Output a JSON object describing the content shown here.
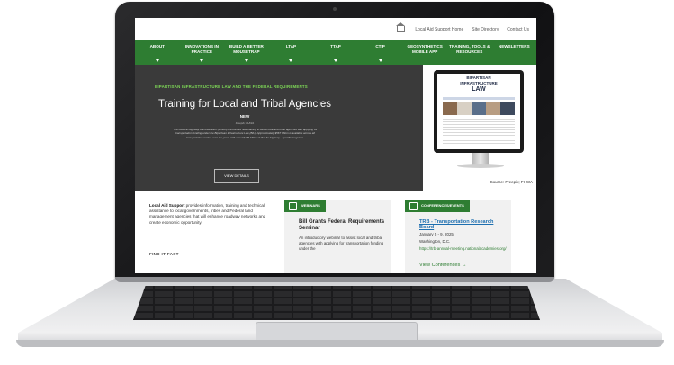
{
  "topbar": {
    "links": [
      "Local Aid Support Home",
      "Site Directory",
      "Contact Us"
    ]
  },
  "nav": {
    "items": [
      {
        "label": "ABOUT"
      },
      {
        "label": "INNOVATIONS IN PRACTICE"
      },
      {
        "label": "BUILD A BETTER MOUSETRAP"
      },
      {
        "label": "LTAP"
      },
      {
        "label": "TTAP"
      },
      {
        "label": "CTIP"
      },
      {
        "label": "GEOSYNTHETICS MOBILE APP"
      },
      {
        "label": "TRAINING, TOOLS & RESOURCES"
      },
      {
        "label": "NEWSLETTERS"
      }
    ]
  },
  "hero": {
    "kicker": "BIPARTISAN INFRASTRUCTURE LAW AND THE FEDERAL REQUIREMENTS",
    "title": "Training for Local and Tribal Agencies",
    "badge": "NEW",
    "credit": "Freepik; FHWA",
    "body": "The Federal Highway Administration (FHWA) announces new training to assist local and tribal agencies with applying for transportation funding under the Bipartisan Infrastructure Law (BIL). Approximately $567 billion is available across all transportation modes over the years with about $125 billion of that for highway - specific programs.",
    "button": "VIEW DETAILS",
    "image": {
      "line1": "BIPARTISAN",
      "line2": "INFRASTRUCTURE",
      "line3": "LAW",
      "source": "Source: Freepik; FHWA"
    }
  },
  "intro": {
    "lead": "Local Aid Support",
    "text": " provides information, training and technical assistance to local governments, tribes and Federal land management agencies that will enhance roadway networks and create economic opportunity."
  },
  "find_it": "FIND IT FAST",
  "webinars": {
    "tag": "WEBINARS",
    "title": "Bill Grants Federal Requirements Seminar",
    "body": "An introductory webinar to assist local and tribal agencies with applying for transportation funding under the"
  },
  "conferences": {
    "tag": "CONFERENCES/EVENTS",
    "link": "TRB - Transportation Research Board",
    "date": "January 5 - 9, 2025",
    "location": "Washington, D.C.",
    "url": "https://trb-annual-meeting.nationalacademies.org/",
    "view": "View Conferences →"
  }
}
